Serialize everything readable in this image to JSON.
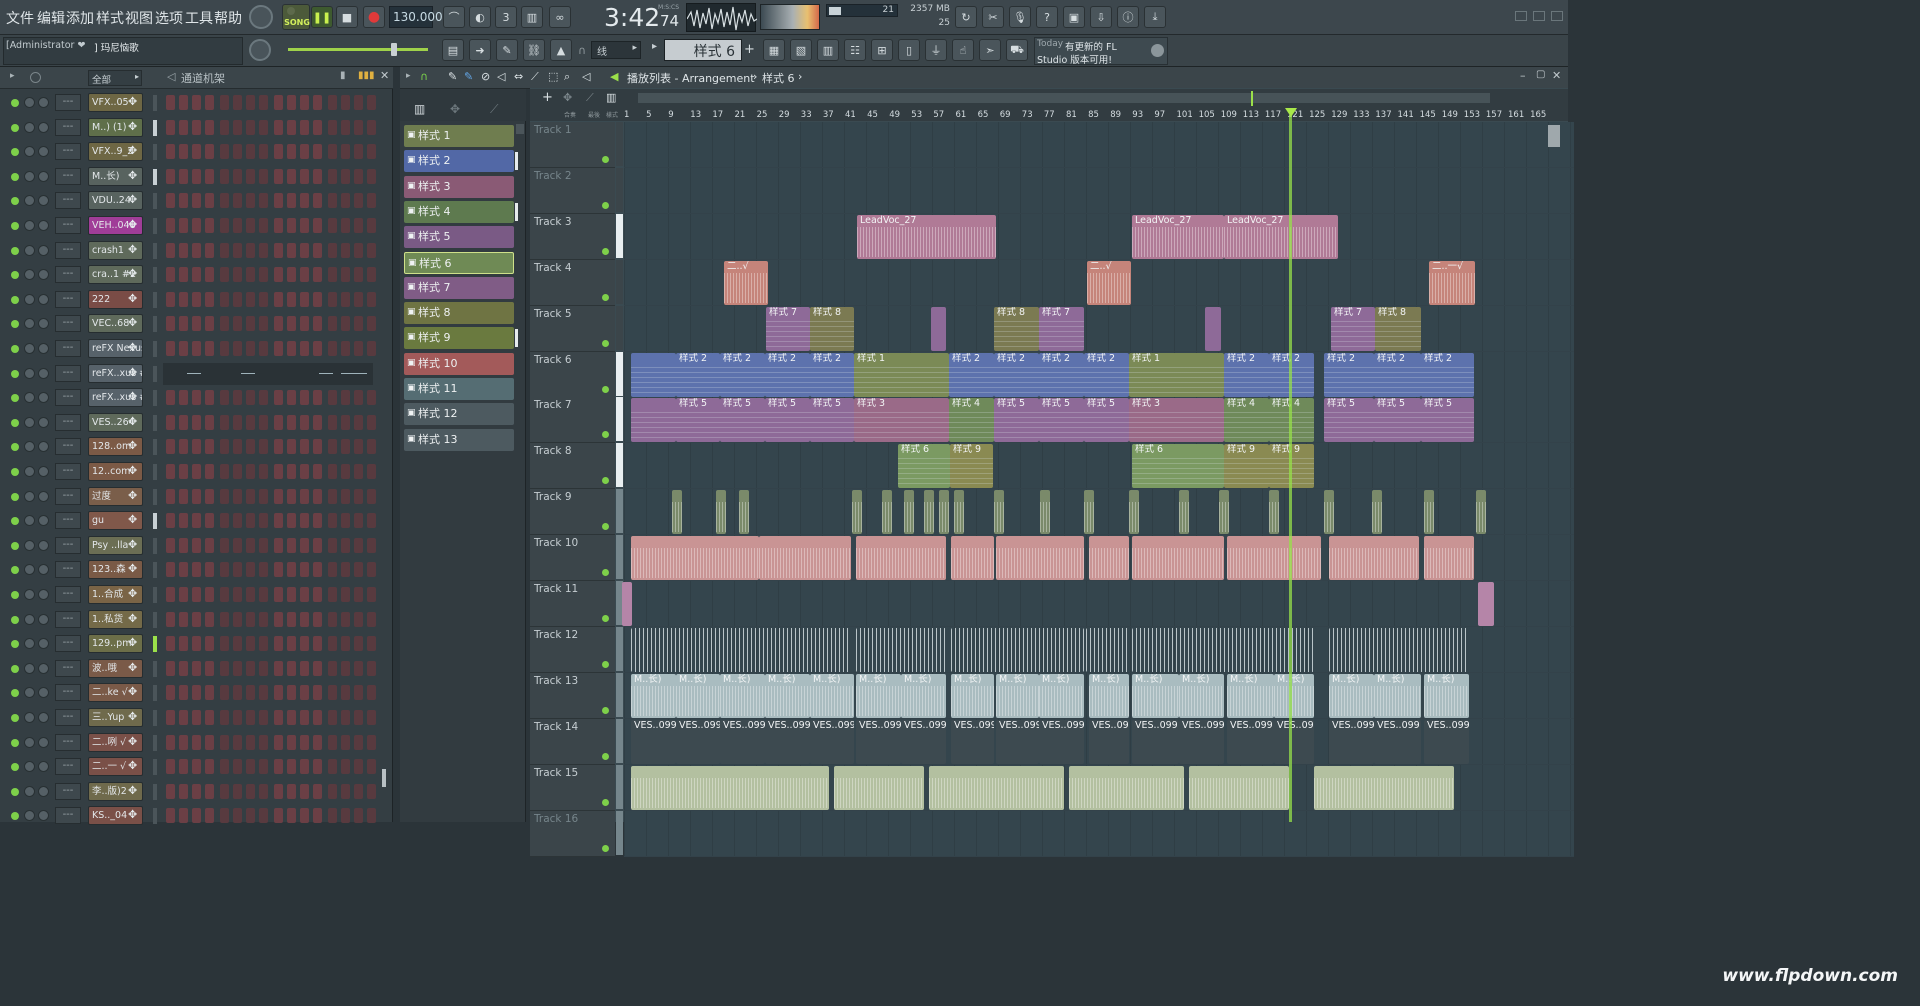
{
  "menu": [
    "文件",
    "编辑",
    "添加",
    "样式",
    "视图",
    "选项",
    "工具",
    "帮助"
  ],
  "transport": {
    "mode_label": "SONG",
    "tempo": "130.000",
    "time": "3:42",
    "time_sub": "74",
    "time_unit": "M:S:CS",
    "cpu_a": "21",
    "mem": "2357 MB",
    "cpu_b": "25"
  },
  "toolbar2": {
    "user": "[Administrator ❤",
    "song_name": "] 玛尼恼歌",
    "snap": "线",
    "pattern": "样式 6",
    "news_line1_prefix": "Today",
    "news_line1": "有更新的 FL",
    "news_line2": "Studio 版本可用!"
  },
  "rack": {
    "filter": "全部",
    "title": "通道机架",
    "channels": [
      {
        "name": "VFX..05",
        "color": "#6e6744"
      },
      {
        "name": "M..) (1)",
        "color": "#5f6f4a"
      },
      {
        "name": "VFX..9_2",
        "color": "#6e6744"
      },
      {
        "name": "M..长)",
        "color": "#58635f"
      },
      {
        "name": "VDU..24",
        "color": "#58635f"
      },
      {
        "name": "VEH..048",
        "color": "#a03d98"
      },
      {
        "name": "crash1",
        "color": "#5f6a5b"
      },
      {
        "name": "cra..1 #2",
        "color": "#5f6a5b"
      },
      {
        "name": "222",
        "color": "#7a4c46"
      },
      {
        "name": "VEC..68",
        "color": "#5f6a5b"
      },
      {
        "name": "reFX Nexus",
        "color": "#57626a"
      },
      {
        "name": "reFX..xus #2",
        "color": "#57626a"
      },
      {
        "name": "reFX..xus #3",
        "color": "#57626a"
      },
      {
        "name": "VES..264",
        "color": "#5f6a5b"
      },
      {
        "name": "128..om",
        "color": "#7c5a46"
      },
      {
        "name": "12..com",
        "color": "#7c5a46"
      },
      {
        "name": "过度",
        "color": "#7a5e4a"
      },
      {
        "name": "gu",
        "color": "#80584a"
      },
      {
        "name": "Psy ..lla",
        "color": "#6b6e54"
      },
      {
        "name": "123..森",
        "color": "#7a5a46"
      },
      {
        "name": "1..合成",
        "color": "#7a6446"
      },
      {
        "name": "1..私货",
        "color": "#746a48"
      },
      {
        "name": "129..pm",
        "color": "#6c6e48"
      },
      {
        "name": "波..哦",
        "color": "#7a5a48"
      },
      {
        "name": "二..ke √",
        "color": "#7a5a48"
      },
      {
        "name": "三..Yup",
        "color": "#6f6a4c"
      },
      {
        "name": "二..咧 √",
        "color": "#7a5048"
      },
      {
        "name": "二..一 √",
        "color": "#7a5048"
      },
      {
        "name": "李..版)2",
        "color": "#6f6a4c"
      },
      {
        "name": "KS.._04",
        "color": "#7a5048"
      }
    ]
  },
  "patterns": [
    {
      "label": "样式 1",
      "color": "#6f7d4f"
    },
    {
      "label": "样式 2",
      "color": "#5268a6"
    },
    {
      "label": "样式 3",
      "color": "#8a5a75"
    },
    {
      "label": "样式 4",
      "color": "#5e7a4f"
    },
    {
      "label": "样式 5",
      "color": "#7a5a85"
    },
    {
      "label": "样式 6",
      "color": "#6f8a55"
    },
    {
      "label": "样式 7",
      "color": "#805c86"
    },
    {
      "label": "样式 8",
      "color": "#6f7443"
    },
    {
      "label": "样式 9",
      "color": "#6a7a3f"
    },
    {
      "label": "样式 10",
      "color": "#a35a5a"
    },
    {
      "label": "样式 11",
      "color": "#556d73"
    },
    {
      "label": "样式 12",
      "color": "#4d5a60"
    },
    {
      "label": "样式 13",
      "color": "#4d5a60"
    }
  ],
  "playlist": {
    "title": "播放列表 - Arrangement",
    "breadcrumb_sep": "›",
    "current_pattern": "样式 6",
    "ruler": [
      "1",
      "5",
      "9",
      "13",
      "17",
      "21",
      "25",
      "29",
      "33",
      "37",
      "41",
      "45",
      "49",
      "53",
      "57",
      "61",
      "65",
      "69",
      "73",
      "77",
      "81",
      "85",
      "89",
      "93",
      "97",
      "101",
      "105",
      "109",
      "113",
      "117",
      "121",
      "125",
      "129",
      "133",
      "137",
      "141",
      "145",
      "149",
      "153",
      "157",
      "161",
      "165"
    ],
    "tracks": [
      "Track 1",
      "Track 2",
      "Track 3",
      "Track 4",
      "Track 5",
      "Track 6",
      "Track 7",
      "Track 8",
      "Track 9",
      "Track 10",
      "Track 11",
      "Track 12",
      "Track 13",
      "Track 14",
      "Track 15",
      "Track 16"
    ],
    "clip_labels": {
      "leadvoc": "LeadVoc_27",
      "er": "二..√",
      "er2": "二..一√",
      "p1": "样式 1",
      "p2": "样式 2",
      "p3": "样式 3",
      "p4": "样式 4",
      "p5": "样式 5",
      "p6": "样式 6",
      "p7": "样式 7",
      "p8": "样式 8",
      "p9": "样式 9",
      "m": "M..长)",
      "ves": "VES..099"
    }
  },
  "watermark": "www.flpdown.com"
}
